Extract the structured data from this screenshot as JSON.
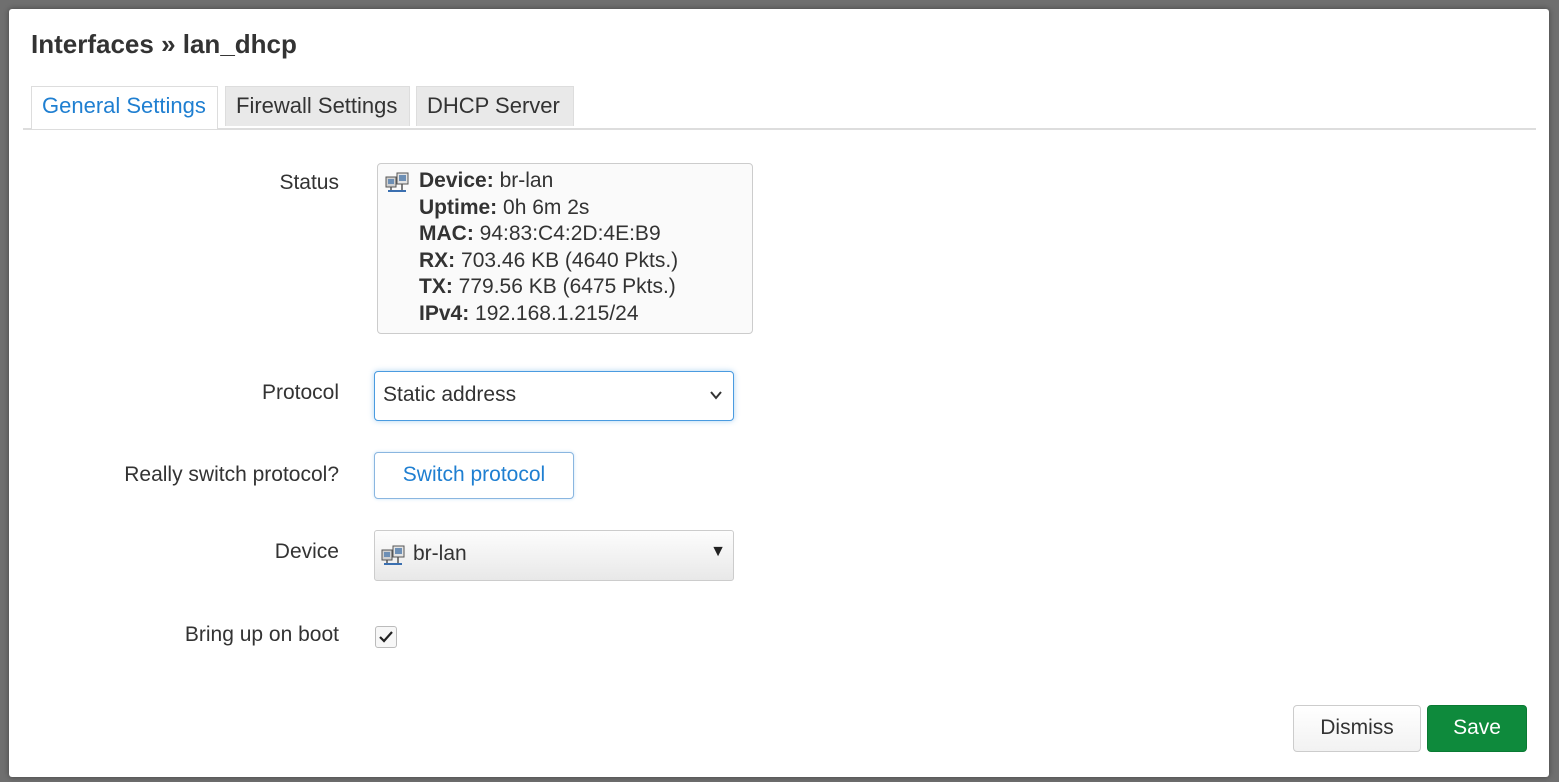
{
  "dialog": {
    "title": "Interfaces » lan_dhcp"
  },
  "tabs": [
    {
      "label": "General Settings",
      "active": true
    },
    {
      "label": "Firewall Settings",
      "active": false
    },
    {
      "label": "DHCP Server",
      "active": false
    }
  ],
  "status": {
    "label": "Status",
    "icon": "network-device-icon",
    "rows": [
      {
        "key": "Device:",
        "value": "br-lan"
      },
      {
        "key": "Uptime:",
        "value": "0h 6m 2s"
      },
      {
        "key": "MAC:",
        "value": "94:83:C4:2D:4E:B9"
      },
      {
        "key": "RX:",
        "value": "703.46 KB (4640 Pkts.)"
      },
      {
        "key": "TX:",
        "value": "779.56 KB (6475 Pkts.)"
      },
      {
        "key": "IPv4:",
        "value": "192.168.1.215/24"
      }
    ]
  },
  "protocol": {
    "label": "Protocol",
    "selected": "Static address"
  },
  "switch_protocol": {
    "label": "Really switch protocol?",
    "button": "Switch protocol"
  },
  "device": {
    "label": "Device",
    "selected": "br-lan"
  },
  "boot": {
    "label": "Bring up on boot",
    "checked": true
  },
  "footer": {
    "dismiss": "Dismiss",
    "save": "Save"
  },
  "colors": {
    "accent": "#1f7fd1",
    "save": "#0e8a3c"
  }
}
